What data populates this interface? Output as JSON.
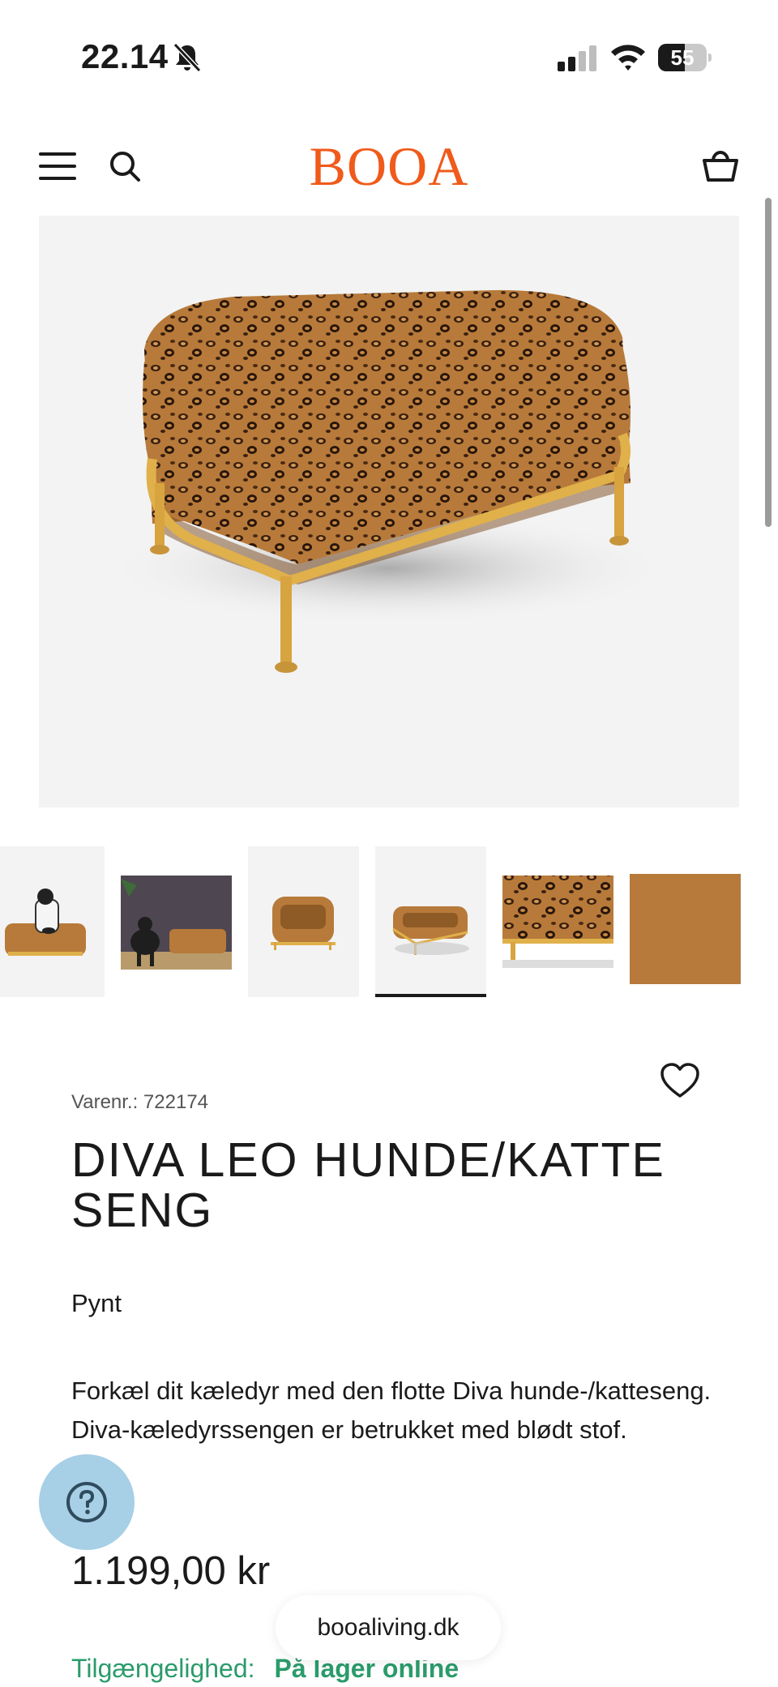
{
  "status_bar": {
    "time": "22.14",
    "battery_level": "55",
    "battery_fraction": 0.55,
    "icons": [
      "bell-slash-icon",
      "cellular-signal-icon",
      "wifi-icon",
      "battery-icon"
    ]
  },
  "header": {
    "logo_text": "BOOA",
    "logo_color": "#f05a1a",
    "icons": [
      "hamburger-menu-icon",
      "search-icon",
      "shopping-basket-icon"
    ]
  },
  "gallery": {
    "thumbnail_count": 6,
    "active_index": 3,
    "thumbnails": [
      "dog-on-bed",
      "french-bulldog-in-room",
      "bed-front-view",
      "bed-angle-view",
      "bed-side-closeup",
      "leopard-fabric-closeup"
    ]
  },
  "product": {
    "sku_label": "Varenr.: 722174",
    "title": "DIVA LEO HUNDE/KATTE SENG",
    "category": "Pynt",
    "description": "Forkæl dit kæledyr med den flotte Diva hunde-/katteseng. Diva-kæledyrssengen er betrukket med blødt stof.",
    "price": "1.199,00 kr",
    "availability_label": "Tilgængelighed:",
    "availability_value": "På lager online",
    "availability_color": "#2b9b6b"
  },
  "help": {
    "icon": "question-mark-icon"
  },
  "browser": {
    "url": "booaliving.dk"
  }
}
